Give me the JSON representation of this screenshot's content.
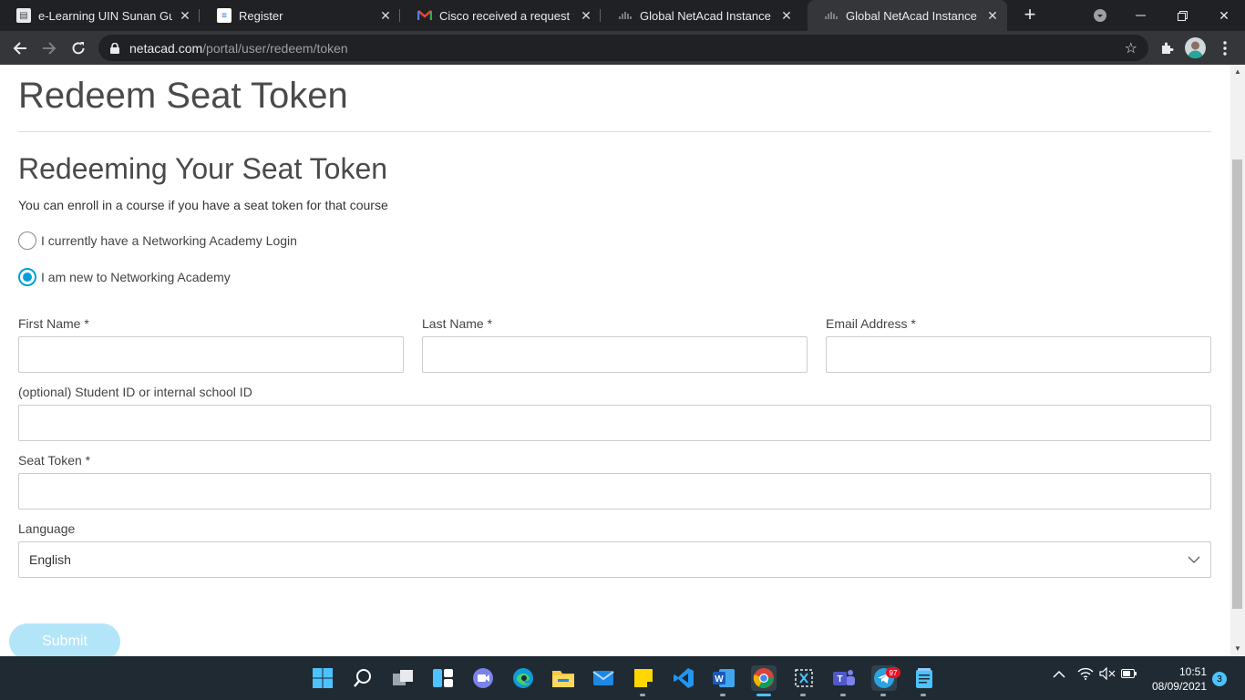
{
  "browser": {
    "tabs": [
      {
        "title": "e-Learning UIN Sunan Gunung Djati",
        "favicon": "elearning-favicon"
      },
      {
        "title": "Register",
        "favicon": "register-favicon"
      },
      {
        "title": "Cisco received a request to update",
        "favicon": "gmail-favicon"
      },
      {
        "title": "Global NetAcad Instance | Redeem",
        "favicon": "cisco-favicon"
      },
      {
        "title": "Global NetAcad Instance | Redeem",
        "favicon": "cisco-favicon",
        "active": true
      }
    ],
    "url_host": "netacad.com",
    "url_path": "/portal/user/redeem/token"
  },
  "page": {
    "title": "Redeem Seat Token",
    "section_title": "Redeeming Your Seat Token",
    "description": "You can enroll in a course if you have a seat token for that course",
    "radio_options": [
      {
        "label": "I currently have a Networking Academy Login",
        "checked": false
      },
      {
        "label": "I am new to Networking Academy",
        "checked": true
      }
    ],
    "fields": {
      "first_name": {
        "label": "First Name *",
        "value": ""
      },
      "last_name": {
        "label": "Last Name *",
        "value": ""
      },
      "email": {
        "label": "Email Address *",
        "value": ""
      },
      "student_id": {
        "label": "(optional) Student ID or internal school ID",
        "value": ""
      },
      "seat_token": {
        "label": "Seat Token *",
        "value": ""
      },
      "language": {
        "label": "Language",
        "value": "English"
      }
    },
    "submit_label": "Submit"
  },
  "taskbar": {
    "apps": [
      "start-icon",
      "search-icon",
      "task-view-icon",
      "widgets-icon",
      "chat-icon",
      "edge-icon",
      "file-explorer-icon",
      "mail-icon",
      "sticky-notes-icon",
      "vscode-icon",
      "word-icon",
      "chrome-icon",
      "snipping-icon",
      "teams-icon",
      "telegram-icon",
      "notepad-icon"
    ],
    "telegram_badge": "97",
    "time": "10:51",
    "date": "08/09/2021",
    "notification_count": "3"
  },
  "colors": {
    "accent": "#049fd9",
    "submit_disabled": "#b3e5f9",
    "chrome_dark": "#202124",
    "chrome_toolbar": "#35363a",
    "taskbar": "#1f2a33"
  }
}
